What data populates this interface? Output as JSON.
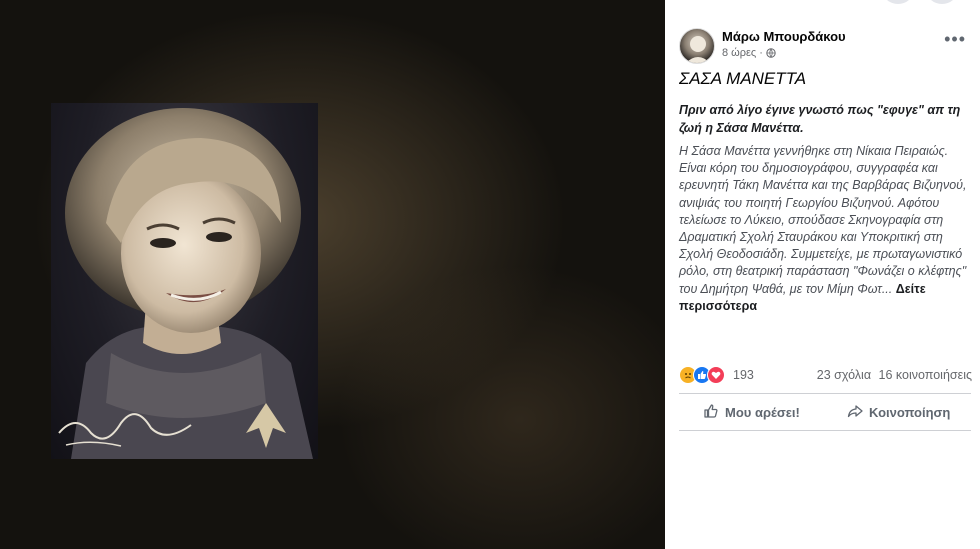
{
  "post": {
    "author": "Μάρω Μπουρδάκου",
    "time": "8 ώρες",
    "separator": "·",
    "title": "ΣΑΣΑ ΜΑΝΕΤΤΑ",
    "lead": "Πριν από λίγο έγινε γνωστό πως \"εφυγε\" απ τη ζωή η Σάσα Μανέττα.",
    "body": "Η Σάσα Μανέττα γεννήθηκε στη Νίκαια Πειραιώς. Είναι κόρη του δημοσιογράφου, συγγραφέα και ερευνητή Τάκη Μανέττα και της Βαρβάρας Βιζυηνού, ανιψιάς του ποιητή Γεωργίου Βιζυηνού. Αφότου τελείωσε το Λύκειο, σπούδασε Σκηνογραφία στη Δραματική Σχολή Σταυράκου και Υποκριτική στη Σχολή Θεοδοσιάδη. Συμμετείχε, με πρωταγωνιστικό ρόλο, στη θεατρική παράσταση \"Φωνάζει ο κλέφτης\" του Δημήτρη Ψαθά, με τον Μίμη Φωτ...",
    "see_more": "Δείτε περισσότερα"
  },
  "stats": {
    "reactions_count": "193",
    "comments": "23 σχόλια",
    "shares": "16 κοινοποιήσεις"
  },
  "actions": {
    "like": "Μου αρέσει!",
    "share": "Κοινοποίηση"
  },
  "photo": {
    "signature": "Ε. Βλαχάκη Πειραιεύς"
  },
  "icons": {
    "privacy": "globe-icon",
    "more": "more-options-icon",
    "reaction_sad": "sad-reaction-icon",
    "reaction_like": "like-reaction-icon",
    "reaction_love": "love-reaction-icon",
    "like_action": "thumbs-up-icon",
    "share_action": "share-arrow-icon"
  },
  "colors": {
    "meta_gray": "#65676b",
    "like_blue": "#1877f2",
    "love_red": "#f33e58",
    "sad_yellow": "#f7b125"
  }
}
